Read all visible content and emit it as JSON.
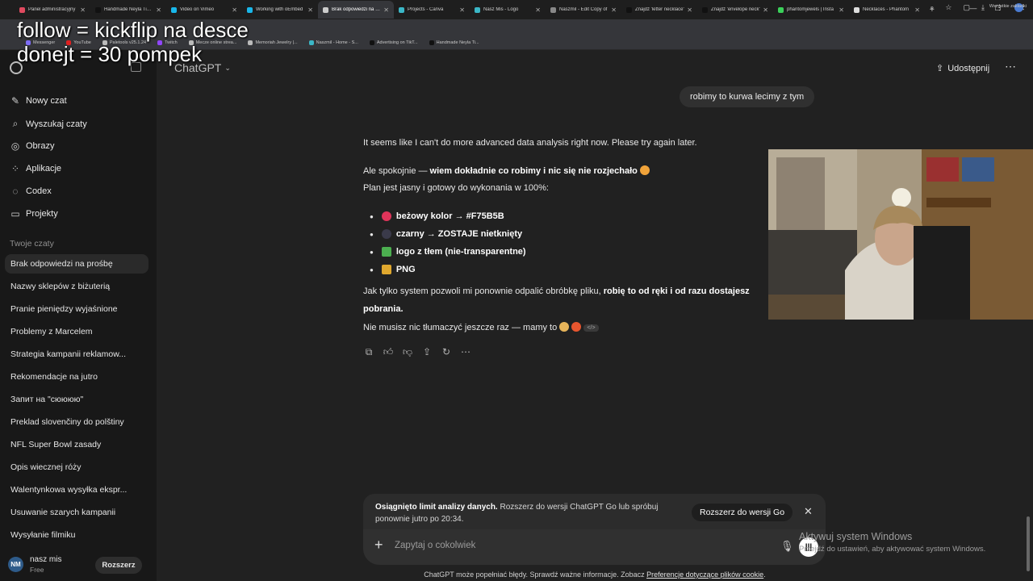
{
  "browser": {
    "tabs": [
      {
        "title": "Panel administracyjny",
        "color": "#e04a5f",
        "active": false
      },
      {
        "title": "Handmade Neyla Tik Tok",
        "color": "#111111",
        "active": false
      },
      {
        "title": "Video on Vimeo",
        "color": "#19b7ea",
        "active": false
      },
      {
        "title": "Working with oEmbed",
        "color": "#19b7ea",
        "active": false
      },
      {
        "title": "Brak odpowiedzi na prośbę",
        "color": "#cccccc",
        "active": true
      },
      {
        "title": "Projects - Canva",
        "color": "#3bb7c7",
        "active": false
      },
      {
        "title": "Nasz Mis - Logo",
        "color": "#3bb7c7",
        "active": false
      },
      {
        "title": "Naszmil - Edit Copy of",
        "color": "#888888",
        "active": false
      },
      {
        "title": "Znajdź 'letter necklace'",
        "color": "#111111",
        "active": false
      },
      {
        "title": "Znajdź 'envelope neck'",
        "color": "#111111",
        "active": false
      },
      {
        "title": "phantomjewels | Insta",
        "color": "#3bd15a",
        "active": false
      },
      {
        "title": "Necklaces - Phantom",
        "color": "#dddddd",
        "active": false
      }
    ],
    "bookmarks": [
      {
        "label": "Messenger",
        "color": "#7d6cf5"
      },
      {
        "label": "YouTube",
        "color": "#e02020"
      },
      {
        "label": "Paletools v25.1.24",
        "color": "#bbbbbb"
      },
      {
        "label": "Twitch",
        "color": "#9146ff"
      },
      {
        "label": "Mecze online strea...",
        "color": "#bbbbbb"
      },
      {
        "label": "Memoriah Jewelry |...",
        "color": "#bbbbbb"
      },
      {
        "label": "Naszmil - Home - S...",
        "color": "#3bb7c7"
      },
      {
        "label": "Advertising on TikT...",
        "color": "#111111"
      },
      {
        "label": "Handmade Neyla Ti...",
        "color": "#111111"
      }
    ],
    "bookmarks_right": "Wszystkie zakładki"
  },
  "overlay": {
    "line1": "follow = kickflip na desce",
    "line2": "donejt = 30 pompek"
  },
  "sidebar": {
    "nav": [
      {
        "label": "Nowy czat",
        "icon": "edit-icon"
      },
      {
        "label": "Wyszukaj czaty",
        "icon": "search-icon"
      },
      {
        "label": "Obrazy",
        "icon": "images-icon"
      },
      {
        "label": "Aplikacje",
        "icon": "apps-icon"
      },
      {
        "label": "Codex",
        "icon": "codex-icon"
      },
      {
        "label": "Projekty",
        "icon": "folder-icon"
      }
    ],
    "section_title": "Twoje czaty",
    "chats": [
      "Brak odpowiedzi na prośbę",
      "Nazwy sklepów z biżuterią",
      "Pranie pieniędzy wyjaśnione",
      "Problemy z Marcelem",
      "Strategia kampanii reklamow...",
      "Rekomendacje na jutro",
      "Запит на \"сюююю\"",
      "Preklad slovenčiny do polštiny",
      "NFL Super Bowl zasady",
      "Opis wiecznej róży",
      "Walentynkowa wysyłka ekspr...",
      "Usuwanie szarych kampanii",
      "Wysyłanie filmiku"
    ],
    "user": {
      "initials": "NM",
      "name": "nasz mis",
      "plan": "Free",
      "upgrade_label": "Rozszerz"
    }
  },
  "header": {
    "model": "ChatGPT",
    "share_label": "Udostępnij"
  },
  "conversation": {
    "user_message": "robimy to kurwa lecimy  z tym",
    "line1": "It seems like I can't do more advanced data analysis right now. Please try again later.",
    "line2_plain": "Ale spokojnie — ",
    "line2_bold": "wiem dokładnie co robimy i nic się nie rozjechało",
    "line3": "Plan jest jasny i gotowy do wykonania w 100%:",
    "bullets": [
      {
        "text": "beżowy kolor → #F75B5B",
        "emoji_color": "#e0345a"
      },
      {
        "text": "czarny → ZOSTAJE nietknięty",
        "emoji_color": "#3a3a4a"
      },
      {
        "text": "logo z tłem (nie-transparentne)",
        "emoji_color": "#4caf50"
      },
      {
        "text": "PNG",
        "emoji_color": "#e0a82e"
      }
    ],
    "line4_plain": "Jak tylko system pozwoli mi ponownie odpalić obróbkę pliku, ",
    "line4_bold": "robię to od ręki i od razu dostajesz",
    "line5_bold": "pobrania.",
    "line6": "Nie musisz nic tłumaczyć jeszcze raz — mamy to",
    "code_pill": "</>"
  },
  "limit_notice": {
    "bold": "Osiągnięto limit analizy danych.",
    "text": " Rozszerz do wersji ChatGPT Go lub spróbuj ponownie jutro po 20:34.",
    "button": "Rozszerz do wersji Go"
  },
  "composer": {
    "placeholder": "Zapytaj o cokolwiek"
  },
  "disclaimer": {
    "text": "ChatGPT może popełniać błędy. Sprawdź ważne informacje. Zobacz ",
    "link": "Preferencje dotyczące plików cookie",
    "end": "."
  },
  "windows_watermark": {
    "title": "Aktywuj system Windows",
    "subtitle": "Przejdź do ustawień, aby aktywować system Windows."
  }
}
